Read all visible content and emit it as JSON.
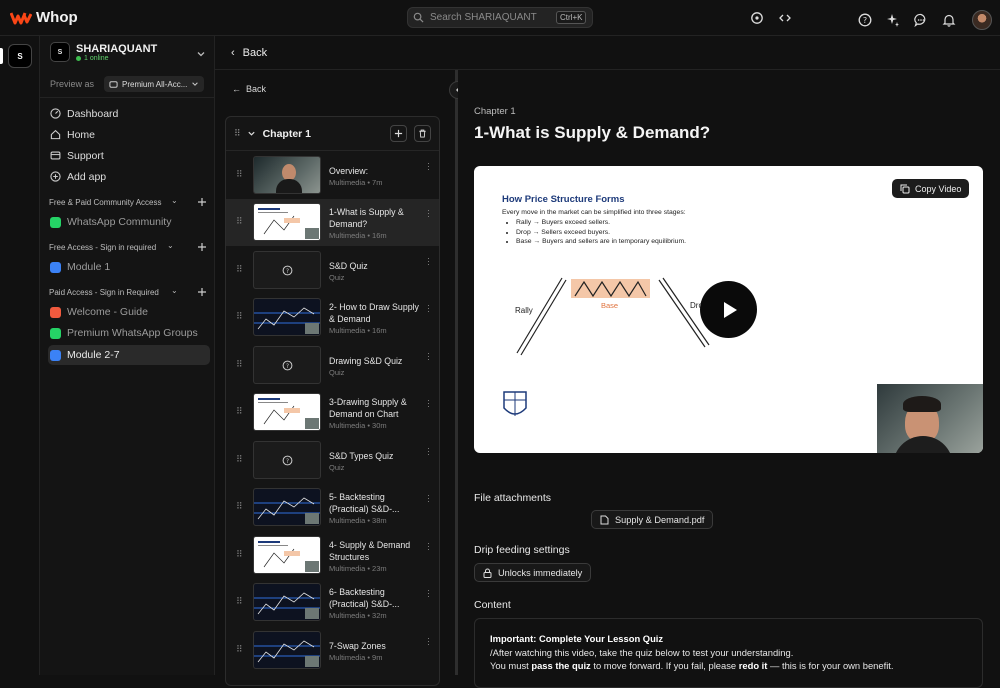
{
  "brand": {
    "name": "Whop",
    "accent": "#fa4616"
  },
  "search": {
    "placeholder": "Search SHARIAQUANT",
    "shortcut": "Ctrl+K"
  },
  "business": {
    "name": "SHARIAQUANT",
    "online": "1 online",
    "logo_text": "S"
  },
  "preview": {
    "label": "Preview as",
    "value": "Premium All-Acc..."
  },
  "nav": [
    {
      "label": "Dashboard",
      "icon": "dashboard-icon"
    },
    {
      "label": "Home",
      "icon": "home-icon"
    },
    {
      "label": "Support",
      "icon": "support-icon"
    },
    {
      "label": "Add app",
      "icon": "plus-circle-icon"
    }
  ],
  "sections": [
    {
      "title": "Free & Paid Community Access",
      "items": [
        {
          "label": "WhatsApp Community",
          "icon": "whatsapp-icon"
        }
      ]
    },
    {
      "title": "Free Access - Sign in required",
      "items": [
        {
          "label": "Module 1",
          "icon": "course-icon"
        }
      ]
    },
    {
      "title": "Paid Access - Sign in Required",
      "items": [
        {
          "label": "Welcome - Guide",
          "icon": "guide-icon"
        },
        {
          "label": "Premium WhatsApp Groups",
          "icon": "whatsapp-icon"
        },
        {
          "label": "Module 2-7",
          "icon": "course-icon",
          "active": true
        }
      ]
    }
  ],
  "contentbar": {
    "back_label": "Back"
  },
  "left": {
    "back_label": "Back",
    "chapter_title": "Chapter 1",
    "lessons": [
      {
        "title": "Overview:",
        "sub": "Multimedia • 7m",
        "kind": "video"
      },
      {
        "title": "1-What is Supply & Demand?",
        "sub": "Multimedia • 16m",
        "kind": "slide",
        "active": true
      },
      {
        "title": "S&D Quiz",
        "sub": "Quiz",
        "kind": "quiz"
      },
      {
        "title": "2- How to Draw Supply & Demand",
        "sub": "Multimedia • 16m",
        "kind": "chart"
      },
      {
        "title": "Drawing S&D Quiz",
        "sub": "Quiz",
        "kind": "quiz"
      },
      {
        "title": "3-Drawing Supply & Demand on Chart",
        "sub": "Multimedia • 30m",
        "kind": "slide"
      },
      {
        "title": "S&D Types Quiz",
        "sub": "Quiz",
        "kind": "quiz"
      },
      {
        "title": "5- Backtesting (Practical) S&D-...",
        "sub": "Multimedia • 38m",
        "kind": "chart"
      },
      {
        "title": "4- Supply & Demand Structures",
        "sub": "Multimedia • 23m",
        "kind": "slide"
      },
      {
        "title": "6- Backtesting (Practical) S&D-...",
        "sub": "Multimedia • 32m",
        "kind": "chart"
      },
      {
        "title": "7-Swap Zones",
        "sub": "Multimedia • 9m",
        "kind": "chart"
      }
    ]
  },
  "lesson": {
    "chapter": "Chapter 1",
    "title": "1-What is Supply & Demand?",
    "copy_video": "Copy Video",
    "slide": {
      "title": "How Price Structure Forms",
      "intro": "Every move in the market can be simplified into three stages:",
      "bullets": [
        "Rally → Buyers exceed sellers.",
        "Drop → Sellers exceed buyers.",
        "Base → Buyers and sellers are in temporary equilibrium."
      ],
      "rally": "Rally",
      "base": "Base",
      "drop": "Drop"
    },
    "attachments_title": "File attachments",
    "attachment": "Supply & Demand.pdf",
    "drip_title": "Drip feeding settings",
    "drip_value": "Unlocks immediately",
    "content_title": "Content",
    "content": {
      "heading": "Important: Complete Your Lesson Quiz",
      "line1": "/After watching this video, take the quiz below to test your understanding.",
      "line2_a": "You must ",
      "line2_b": "pass the quiz",
      "line2_c": " to move forward. If you fail, please ",
      "line2_d": "redo it",
      "line2_e": " — this is for your own benefit."
    }
  }
}
